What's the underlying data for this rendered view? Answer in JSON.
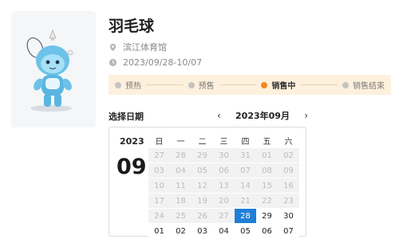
{
  "event": {
    "title": "羽毛球",
    "venue": "滨江体育馆",
    "date_range": "2023/09/28-10/07"
  },
  "stages": [
    {
      "label": "预热",
      "active": false
    },
    {
      "label": "预售",
      "active": false
    },
    {
      "label": "销售中",
      "active": true
    },
    {
      "label": "销售结束",
      "active": false
    }
  ],
  "date_picker": {
    "label": "选择日期",
    "current_month": "2023年09月",
    "year": "2023",
    "month": "09",
    "weekdays": [
      "日",
      "一",
      "二",
      "三",
      "四",
      "五",
      "六"
    ],
    "days": [
      {
        "d": "27",
        "state": "disabled"
      },
      {
        "d": "28",
        "state": "disabled"
      },
      {
        "d": "29",
        "state": "disabled"
      },
      {
        "d": "30",
        "state": "disabled"
      },
      {
        "d": "31",
        "state": "disabled"
      },
      {
        "d": "01",
        "state": "disabled"
      },
      {
        "d": "02",
        "state": "disabled"
      },
      {
        "d": "03",
        "state": "disabled"
      },
      {
        "d": "04",
        "state": "disabled"
      },
      {
        "d": "05",
        "state": "disabled"
      },
      {
        "d": "06",
        "state": "disabled"
      },
      {
        "d": "07",
        "state": "disabled"
      },
      {
        "d": "08",
        "state": "disabled"
      },
      {
        "d": "09",
        "state": "disabled"
      },
      {
        "d": "10",
        "state": "disabled"
      },
      {
        "d": "11",
        "state": "disabled"
      },
      {
        "d": "12",
        "state": "disabled"
      },
      {
        "d": "13",
        "state": "disabled"
      },
      {
        "d": "14",
        "state": "disabled"
      },
      {
        "d": "15",
        "state": "disabled"
      },
      {
        "d": "16",
        "state": "disabled"
      },
      {
        "d": "17",
        "state": "disabled"
      },
      {
        "d": "18",
        "state": "disabled"
      },
      {
        "d": "19",
        "state": "disabled"
      },
      {
        "d": "20",
        "state": "disabled"
      },
      {
        "d": "21",
        "state": "disabled"
      },
      {
        "d": "22",
        "state": "disabled"
      },
      {
        "d": "23",
        "state": "disabled"
      },
      {
        "d": "24",
        "state": "disabled"
      },
      {
        "d": "25",
        "state": "disabled"
      },
      {
        "d": "26",
        "state": "disabled"
      },
      {
        "d": "27",
        "state": "disabled"
      },
      {
        "d": "28",
        "state": "selected"
      },
      {
        "d": "29",
        "state": "avail"
      },
      {
        "d": "30",
        "state": "avail"
      },
      {
        "d": "01",
        "state": "avail"
      },
      {
        "d": "02",
        "state": "avail"
      },
      {
        "d": "03",
        "state": "avail"
      },
      {
        "d": "04",
        "state": "avail"
      },
      {
        "d": "05",
        "state": "avail"
      },
      {
        "d": "06",
        "state": "avail"
      },
      {
        "d": "07",
        "state": "avail"
      }
    ]
  },
  "colors": {
    "accent": "#f08a22",
    "selected": "#1e7fd6",
    "status_bg": "#fdf0dc"
  },
  "icons": {
    "venue": "location-pin-icon",
    "date": "clock-icon",
    "prev": "chevron-left-icon",
    "next": "chevron-right-icon"
  }
}
